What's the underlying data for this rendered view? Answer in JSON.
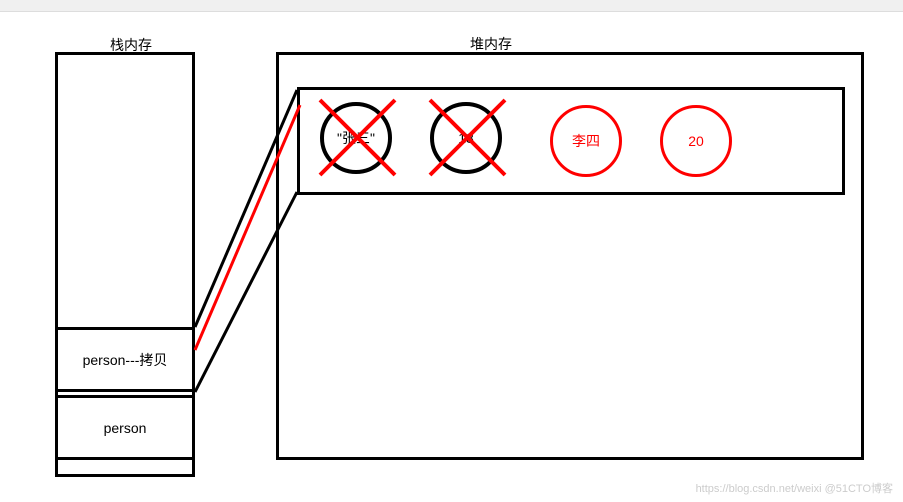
{
  "labels": {
    "stack": "栈内存",
    "heap": "堆内存"
  },
  "stack": {
    "slot1": "person---拷贝",
    "slot2": "person"
  },
  "heap": {
    "obj1_name": "\"张三\"",
    "obj1_age": "18",
    "obj2_name": "李四",
    "obj2_age": "20"
  },
  "watermark": "https://blog.csdn.net/weixi @51CTO博客"
}
